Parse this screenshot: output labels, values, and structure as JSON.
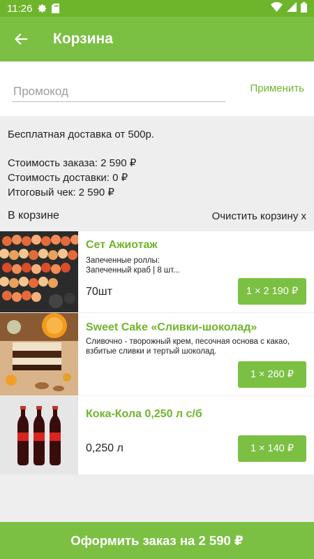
{
  "status_bar": {
    "time": "11:26",
    "icons": [
      "gear-icon",
      "sd-card-icon",
      "wifi-icon",
      "signal-icon",
      "battery-icon"
    ]
  },
  "app_bar": {
    "title": "Корзина",
    "back_icon": "arrow-left-icon"
  },
  "promo": {
    "placeholder": "Промокод",
    "value": "",
    "apply_label": "Применить"
  },
  "info": {
    "free_delivery": "Бесплатная доставка от 500р.",
    "order_cost": "Стоимость заказа: 2 590 ₽",
    "delivery_cost": "Стоимость доставки: 0 ₽",
    "total": "Итоговый чек: 2 590 ₽"
  },
  "cart": {
    "header": "В корзине",
    "clear_label": "Очистить корзину x",
    "items": [
      {
        "name": "Сет Ажиотаж",
        "description": "Запеченные роллы:\nЗапеченный краб | 8 шт...",
        "quantity": "70шт",
        "price_button": "1 × 2 190 ₽"
      },
      {
        "name": "Sweet Cake «Сливки-шоколад»",
        "description": "Сливочно - творожный крем, песочная основа с какао, взбитые сливки и тертый шоколад.",
        "quantity": "",
        "price_button": "1 × 260 ₽"
      },
      {
        "name": "Кока-Кола 0,250 л с/б",
        "description": "",
        "quantity": "0,250 л",
        "price_button": "1 × 140 ₽"
      }
    ]
  },
  "checkout": {
    "label": "Оформить заказ на 2 590 ₽"
  },
  "colors": {
    "primary": "#7bc043",
    "status_bar": "#6fb52c",
    "accent_text": "#6fb52c"
  }
}
